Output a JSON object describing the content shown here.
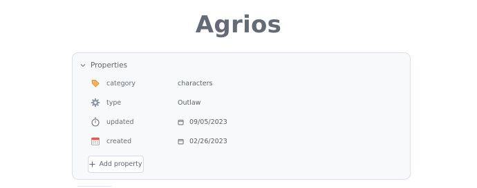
{
  "page": {
    "title": "Agrios"
  },
  "properties": {
    "header_label": "Properties",
    "items": [
      {
        "icon": "tag-icon",
        "key": "category",
        "value": "characters",
        "is_date": false
      },
      {
        "icon": "gear-icon",
        "key": "type",
        "value": "Outlaw",
        "is_date": false
      },
      {
        "icon": "stopwatch-icon",
        "key": "updated",
        "value": "09/05/2023",
        "is_date": true
      },
      {
        "icon": "calendar-icon",
        "key": "created",
        "value": "02/26/2023",
        "is_date": true
      }
    ],
    "add_label": "Add property"
  },
  "colors": {
    "title": "#656b76",
    "panel_bg": "#f8f9fb",
    "panel_border": "#dcdfe4",
    "tag_icon": "#e8a44a",
    "gear_icon": "#8c96a3",
    "calendar_icon": "#d9534f"
  }
}
